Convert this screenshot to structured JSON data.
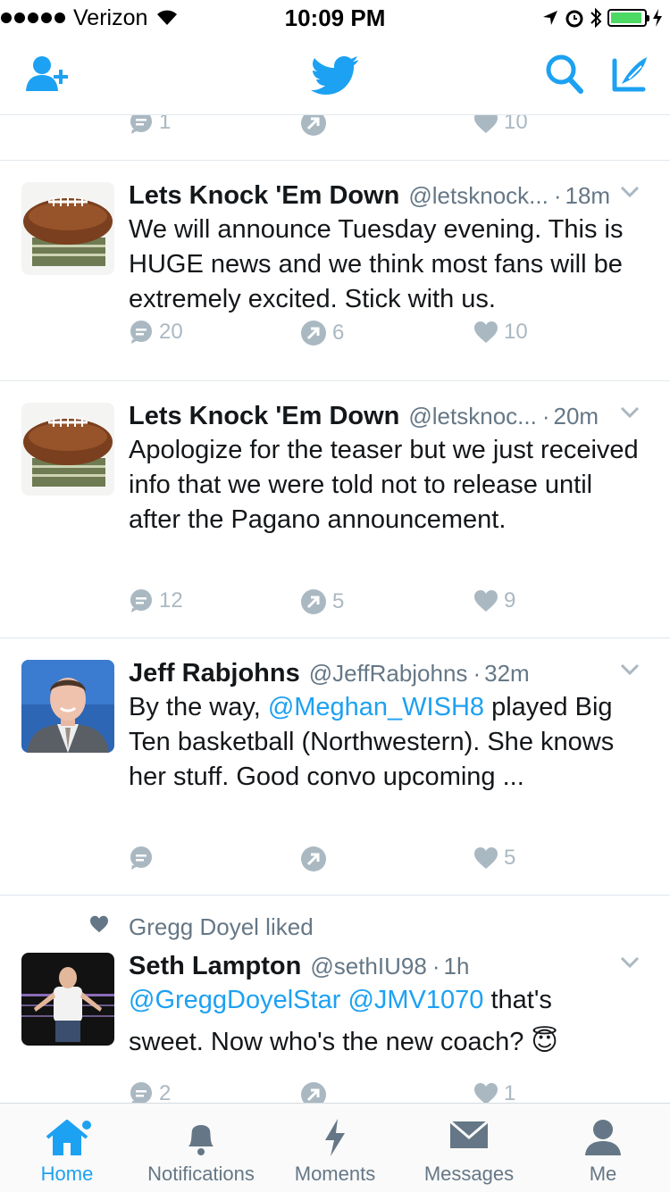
{
  "status_bar": {
    "carrier": "Verizon",
    "time": "10:09 PM",
    "battery_level": 0.85
  },
  "nav": {
    "add_user_icon": "add-user-icon",
    "logo": "twitter-bird-icon",
    "search_icon": "search-icon",
    "compose_icon": "compose-icon"
  },
  "colors": {
    "accent": "#1da1f2",
    "muted": "#aab8c2",
    "divider": "#e1e8ed"
  },
  "partial_tweet": {
    "replies": "1",
    "retweets": "",
    "likes": "10"
  },
  "tweets": [
    {
      "name": "Lets Knock 'Em Down",
      "handle": "@letsknock...",
      "time": "18m",
      "text": "We will announce Tuesday evening.  This is HUGE news and we think most fans will be extremely excited.  Stick with us.",
      "replies": "20",
      "retweets": "6",
      "likes": "10"
    },
    {
      "name": "Lets Knock 'Em Down",
      "handle": "@letsknoc...",
      "time": "20m",
      "text": "Apologize for the teaser but we just received info that we were told not to release until after the Pagano announcement.",
      "replies": "12",
      "retweets": "5",
      "likes": "9"
    },
    {
      "name": "Jeff Rabjohns",
      "handle": "@JeffRabjohns",
      "time": "32m",
      "text_pre": "By the way, ",
      "mention": "@Meghan_WISH8",
      "text_post": " played Big Ten basketball (Northwestern). She knows her stuff. Good convo upcoming ...",
      "replies": "",
      "retweets": "",
      "likes": "5"
    },
    {
      "liked_by": "Gregg Doyel liked",
      "name": "Seth Lampton",
      "handle": "@sethIU98",
      "time": "1h",
      "mention1": "@GreggDoyelStar",
      "mention2": "@JMV1070",
      "text_a": " that's",
      "text_b": "sweet.  Now who's the new coach? ",
      "emoji": "😇",
      "replies": "2",
      "retweets": "",
      "likes": "1"
    }
  ],
  "tabs": [
    {
      "label": "Home",
      "icon": "home-icon",
      "active": true
    },
    {
      "label": "Notifications",
      "icon": "bell-icon",
      "active": false
    },
    {
      "label": "Moments",
      "icon": "lightning-icon",
      "active": false
    },
    {
      "label": "Messages",
      "icon": "envelope-icon",
      "active": false
    },
    {
      "label": "Me",
      "icon": "person-icon",
      "active": false
    }
  ]
}
